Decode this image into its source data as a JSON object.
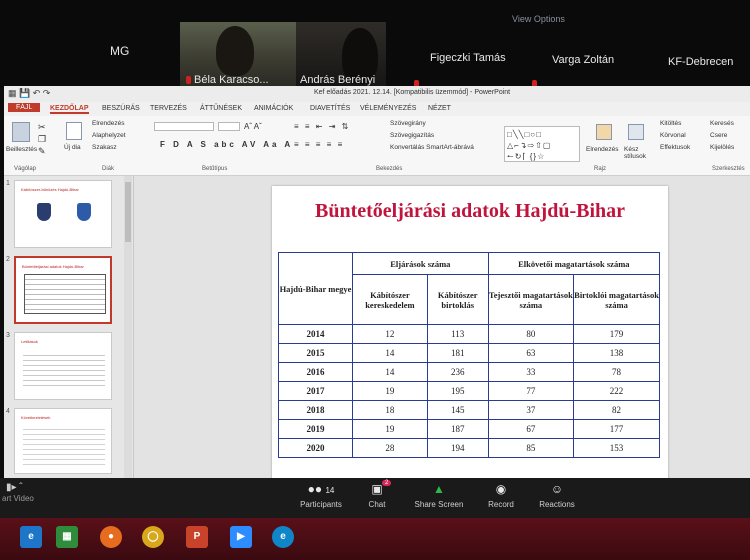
{
  "zoom": {
    "view_options": "View Options",
    "participants_tiles": [
      {
        "name": "MG"
      },
      {
        "name": "Béla Karacso..."
      },
      {
        "name": "András Berényi"
      },
      {
        "name": "Figeczki Tamás"
      },
      {
        "name": "Varga Zoltán"
      },
      {
        "name": "KF-Debrecen"
      }
    ],
    "controls": {
      "start_video": "art Video",
      "participants": "Participants",
      "participants_count": "14",
      "chat": "Chat",
      "chat_badge": "2",
      "share_screen": "Share Screen",
      "record": "Record",
      "reactions": "Reactions"
    }
  },
  "ppt": {
    "title": "Kef előadás 2021. 12.14. [Kompatibilis üzemmód] - PowerPoint",
    "tabs": [
      "FÁJL",
      "KEZDŐLAP",
      "BESZÚRÁS",
      "TERVEZÉS",
      "ÁTTŰNÉSEK",
      "ANIMÁCIÓK",
      "DIAVETÍTÉS",
      "VÉLEMÉNYEZÉS",
      "NÉZET"
    ],
    "ribbon": {
      "groups": [
        "Vágólap",
        "Diák",
        "Betűtípus",
        "Bekezdés",
        "Rajz",
        "Szerkesztés"
      ],
      "beillesztes": "Beillesztés",
      "uj_dia": "Új dia",
      "elrendezes": "Elrendezés",
      "alaphelyzet": "Alaphelyzet",
      "szakasz": "Szakasz",
      "szovegirany": "Szövegirány",
      "szovegigazitas": "Szövegigazítás",
      "smartart": "Konvertálás SmartArt-ábrává",
      "elrendezes2": "Elrendezés",
      "gyors_stilusok": "Kész stílusok",
      "kitoltes": "Kitöltés",
      "korvonal": "Körvonal",
      "effektusok": "Effektusok",
      "kereses": "Keresés",
      "csere": "Csere",
      "kijeloles": "Kijelölés"
    },
    "thumbnails": [
      {
        "num": "1",
        "title": "Kábítószer-bűnözés Hajdú-Bihar"
      },
      {
        "num": "2",
        "title": "Büntetőeljárási adatok Hajdú-Bihar"
      },
      {
        "num": "3",
        "title": "Letiltások"
      },
      {
        "num": "4",
        "title": "Következtetések"
      }
    ],
    "slide": {
      "title": "Büntetőeljárási adatok Hajdú-Bihar",
      "table": {
        "row_header": "Hajdú-Bihar megye",
        "group1": "Eljárások száma",
        "group2": "Elkövetői magatartások száma",
        "cols": [
          "Kábítószer kereskedelem",
          "Kábítószer birtoklás",
          "Tejesztői magatartások száma",
          "Birtoklói magatartások száma"
        ],
        "rows": [
          {
            "year": "2014",
            "v": [
              "12",
              "113",
              "80",
              "179"
            ]
          },
          {
            "year": "2015",
            "v": [
              "14",
              "181",
              "63",
              "138"
            ]
          },
          {
            "year": "2016",
            "v": [
              "14",
              "236",
              "33",
              "78"
            ]
          },
          {
            "year": "2017",
            "v": [
              "19",
              "195",
              "77",
              "222"
            ]
          },
          {
            "year": "2018",
            "v": [
              "18",
              "145",
              "37",
              "82"
            ]
          },
          {
            "year": "2019",
            "v": [
              "19",
              "187",
              "67",
              "177"
            ]
          },
          {
            "year": "2020",
            "v": [
              "28",
              "194",
              "85",
              "153"
            ]
          }
        ]
      }
    }
  }
}
